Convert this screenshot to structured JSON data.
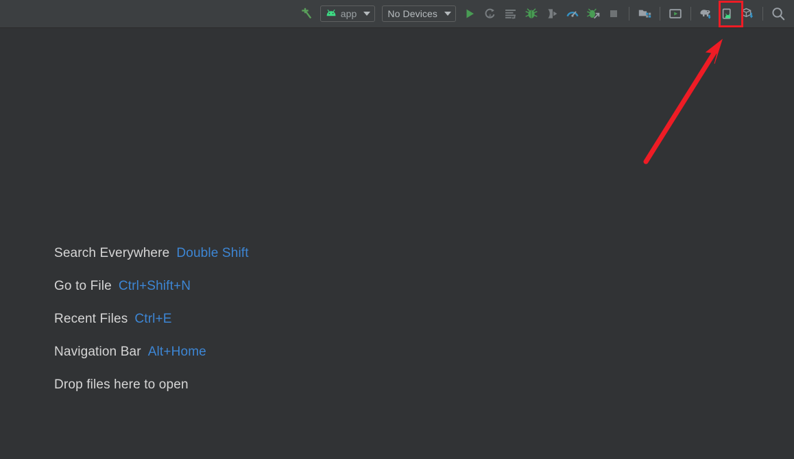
{
  "window": {
    "background_color": "#313335",
    "toolbar_background_color": "#3c3f41"
  },
  "toolbar": {
    "build_button": {
      "name": "Make Project",
      "icon": "hammer-icon",
      "color": "#5a9e5a"
    },
    "module_combo": {
      "label": "app",
      "icon": "android-head-icon",
      "icon_color": "#3ddc84"
    },
    "device_combo": {
      "label": "No Devices"
    },
    "actions": [
      {
        "id": "run",
        "icon": "run-icon",
        "title": "Run",
        "color": "#499c54"
      },
      {
        "id": "apply-changes",
        "icon": "apply-changes-icon",
        "title": "Apply Changes and Restart Activity",
        "color": "#787d80"
      },
      {
        "id": "apply-code-changes",
        "icon": "apply-code-changes-icon",
        "title": "Apply Code Changes",
        "color": "#787d80"
      },
      {
        "id": "debug",
        "icon": "debug-bug-icon",
        "title": "Debug",
        "color": "#499c54"
      },
      {
        "id": "attach-debugger",
        "icon": "attach-debugger-icon",
        "title": "Attach Debugger to Android Process",
        "color": "#787d80"
      },
      {
        "id": "profiler",
        "icon": "profiler-gauge-icon",
        "title": "Profile",
        "color": "#3592c4"
      },
      {
        "id": "attach-process",
        "icon": "attach-process-icon",
        "title": "Attach Debugger to Process",
        "color": "#499c54"
      },
      {
        "id": "stop",
        "icon": "stop-square-icon",
        "title": "Stop",
        "color": "#6e7274"
      },
      {
        "id": "project-structure",
        "icon": "project-structure-icon",
        "title": "Project Structure",
        "color": "#9aa0a6"
      },
      {
        "id": "avd-manager",
        "icon": "avd-manager-icon",
        "title": "AVD Manager",
        "color": "#9aa0a6"
      },
      {
        "id": "sdk-manager",
        "icon": "gradle-elephant-icon",
        "title": "SDK Manager",
        "color": "#9aa0a6"
      },
      {
        "id": "device-manager",
        "icon": "device-manager-icon",
        "title": "Device Manager",
        "color": "#9aa0a6",
        "highlighted": true
      },
      {
        "id": "sync-gradle",
        "icon": "sync-gradle-cube-icon",
        "title": "Sync Project with Gradle Files",
        "color": "#9aa0a6"
      },
      {
        "id": "search-everywhere",
        "icon": "search-icon",
        "title": "Search Everywhere",
        "color": "#9aa0a6"
      }
    ]
  },
  "annotation": {
    "highlight_color": "#ee1c25",
    "arrow_color": "#ee1c25",
    "target_action_id": "device-manager"
  },
  "editor_hints": {
    "rows": [
      {
        "label": "Search Everywhere",
        "shortcut": "Double Shift"
      },
      {
        "label": "Go to File",
        "shortcut": "Ctrl+Shift+N"
      },
      {
        "label": "Recent Files",
        "shortcut": "Ctrl+E"
      },
      {
        "label": "Navigation Bar",
        "shortcut": "Alt+Home"
      },
      {
        "label": "Drop files here to open",
        "shortcut": ""
      }
    ],
    "label_color": "#d6d6d6",
    "shortcut_color": "#3d86d4"
  }
}
